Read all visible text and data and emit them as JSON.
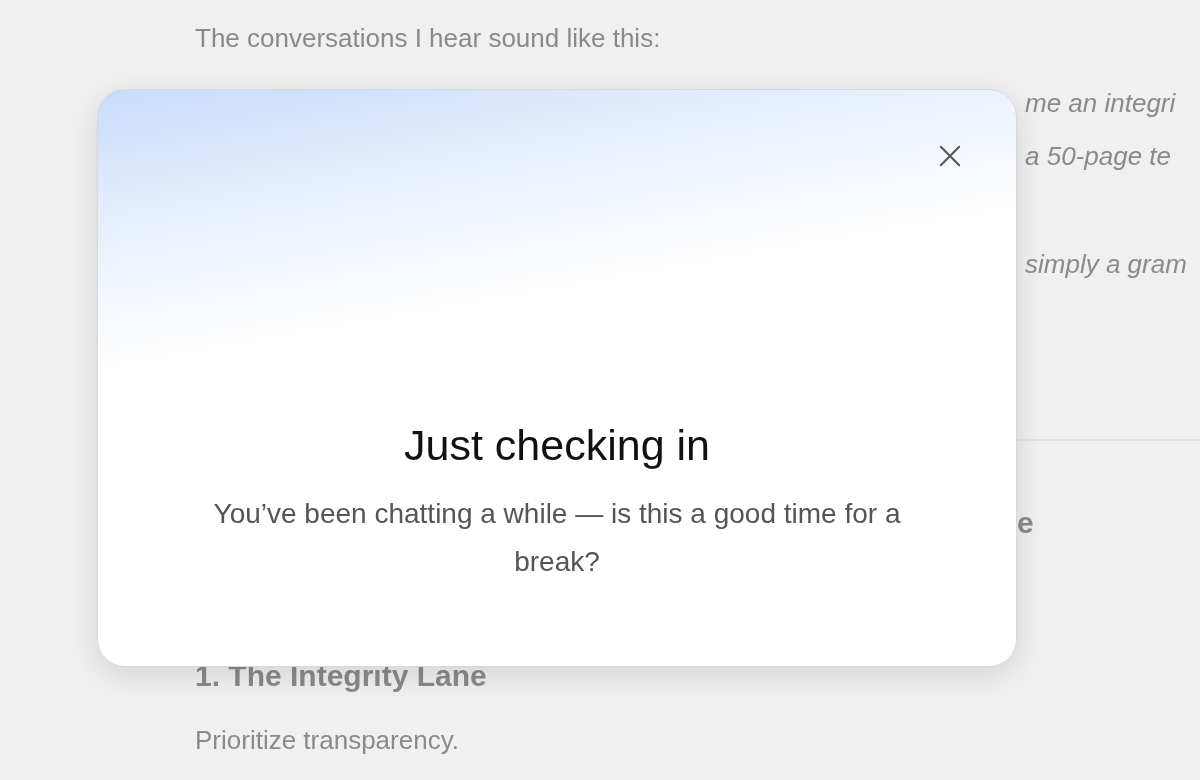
{
  "background": {
    "intro": "The conversations I hear sound like this:",
    "fragments": [
      {
        "text": "me an integri",
        "kind": "italic"
      },
      {
        "text": "a 50-page te",
        "kind": "italic"
      },
      {
        "text": "simply a gram",
        "kind": "italic"
      },
      {
        "text": "e",
        "kind": "heading"
      }
    ],
    "section_heading": "1. The Integrity Lane",
    "section_text": "Prioritize transparency."
  },
  "dialog": {
    "title": "Just checking in",
    "message": "You’ve been chatting a while — is this a good time for a break?"
  }
}
